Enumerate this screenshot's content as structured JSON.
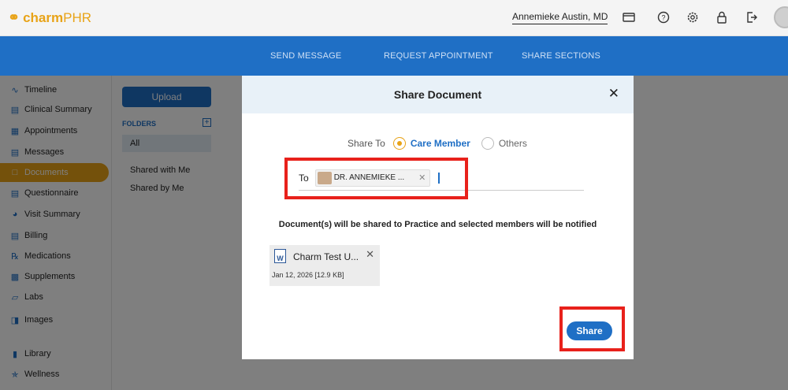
{
  "app": {
    "logo_charm": "charm",
    "logo_phr": "PHR",
    "user_name": "Annemieke Austin, MD"
  },
  "header_icons": [
    "card-icon",
    "help-icon",
    "settings-icon",
    "lock-icon",
    "logout-icon"
  ],
  "topnav": {
    "send_message": "SEND MESSAGE",
    "request_appointment": "REQUEST APPOINTMENT",
    "share_sections": "SHARE SECTIONS"
  },
  "sidebar": {
    "items": [
      {
        "label": "Timeline",
        "icon": "timeline-icon"
      },
      {
        "label": "Clinical Summary",
        "icon": "clipboard-icon"
      },
      {
        "label": "Appointments",
        "icon": "calendar-icon"
      },
      {
        "label": "Messages",
        "icon": "message-icon"
      },
      {
        "label": "Documents",
        "icon": "folder-icon"
      },
      {
        "label": "Questionnaire",
        "icon": "questionnaire-icon"
      },
      {
        "label": "Visit Summary",
        "icon": "visit-icon"
      },
      {
        "label": "Billing",
        "icon": "billing-icon"
      },
      {
        "label": "Medications",
        "icon": "rx-icon"
      },
      {
        "label": "Supplements",
        "icon": "supplement-icon"
      },
      {
        "label": "Labs",
        "icon": "lab-icon"
      },
      {
        "label": "Images",
        "icon": "image-icon"
      },
      {
        "label": "Library",
        "icon": "library-icon"
      },
      {
        "label": "Wellness",
        "icon": "wellness-icon"
      }
    ],
    "active": "Documents"
  },
  "documents_panel": {
    "upload_label": "Upload",
    "folders_label": "FOLDERS",
    "folders": [
      "All",
      "Shared with Me",
      "Shared by Me"
    ],
    "selected_folder": "All"
  },
  "modal": {
    "title": "Share Document",
    "share_to_label": "Share To",
    "options": [
      "Care Member",
      "Others"
    ],
    "selected_option": "Care Member",
    "to_label": "To",
    "recipient_chip": "DR. ANNEMIEKE ...",
    "notice": "Document(s) will be shared to Practice and selected members will be notified",
    "document": {
      "name": "Charm Test U...",
      "meta": "Jan 12, 2026  [12.9 KB]",
      "icon_letter": "W"
    },
    "share_button": "Share"
  },
  "colors": {
    "brand_blue": "#1f6fc5",
    "brand_orange": "#e8a317",
    "highlight_red": "#e8211b"
  }
}
